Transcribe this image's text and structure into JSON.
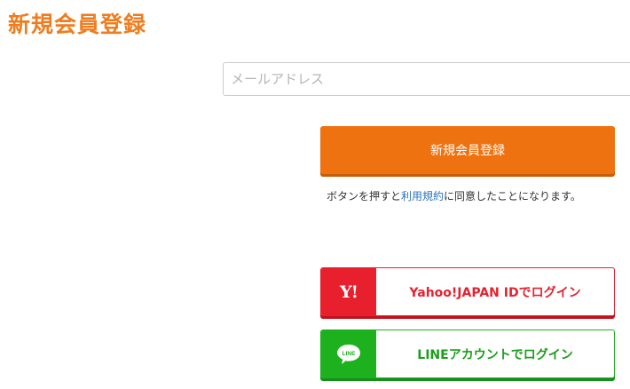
{
  "page": {
    "title": "新規会員登録"
  },
  "form": {
    "email_placeholder": "メールアドレス",
    "submit_label": "新規会員登録",
    "terms": {
      "prefix": "ボタンを押すと",
      "link": "利用規約",
      "suffix": "に同意したことになります。"
    }
  },
  "social_login": {
    "yahoo": {
      "logo_text": "Y!",
      "label": "Yahoo!JAPAN IDでログイン",
      "color": "#e8202e",
      "icon": "yahoo-logo-icon"
    },
    "line": {
      "logo_text": "LINE",
      "label": "LINEアカウントでログイン",
      "color": "#1db21d",
      "icon": "line-logo-icon"
    }
  },
  "colors": {
    "accent": "#ef7211",
    "title": "#ef7d1f",
    "link": "#2b74b8"
  }
}
